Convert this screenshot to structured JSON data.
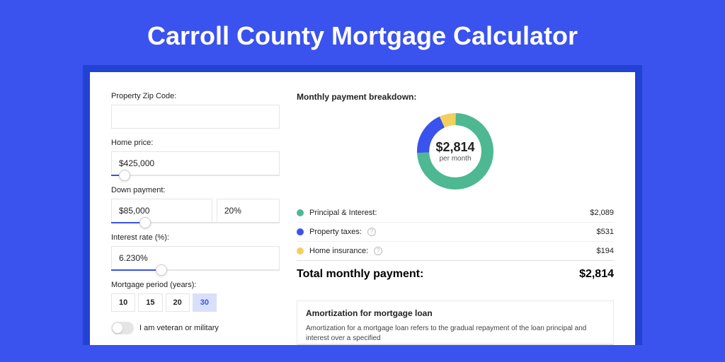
{
  "title": "Carroll County Mortgage Calculator",
  "form": {
    "zip": {
      "label": "Property Zip Code:",
      "value": ""
    },
    "price": {
      "label": "Home price:",
      "value": "$425,000",
      "slider_pct": 8
    },
    "down": {
      "label": "Down payment:",
      "amount": "$85,000",
      "percent": "20%",
      "slider_pct": 20
    },
    "rate": {
      "label": "Interest rate (%):",
      "value": "6.230%",
      "slider_pct": 30
    },
    "period": {
      "label": "Mortgage period (years):",
      "options": [
        "10",
        "15",
        "20",
        "30"
      ],
      "active": "30"
    },
    "veteran": "I am veteran or military"
  },
  "breakdown": {
    "title": "Monthly payment breakdown:",
    "center_amount": "$2,814",
    "center_sub": "per month",
    "rows": [
      {
        "color": "green",
        "label": "Principal & Interest:",
        "help": false,
        "value": "$2,089"
      },
      {
        "color": "blue",
        "label": "Property taxes:",
        "help": true,
        "value": "$531"
      },
      {
        "color": "yellow",
        "label": "Home insurance:",
        "help": true,
        "value": "$194"
      }
    ],
    "total_label": "Total monthly payment:",
    "total_value": "$2,814"
  },
  "amort": {
    "title": "Amortization for mortgage loan",
    "text": "Amortization for a mortgage loan refers to the gradual repayment of the loan principal and interest over a specified"
  },
  "chart_data": {
    "type": "pie",
    "title": "Monthly payment breakdown",
    "series": [
      {
        "name": "Principal & Interest",
        "value": 2089,
        "color": "#4db892"
      },
      {
        "name": "Property taxes",
        "value": 531,
        "color": "#3a52ee"
      },
      {
        "name": "Home insurance",
        "value": 194,
        "color": "#f4cf5e"
      }
    ],
    "total": 2814
  }
}
